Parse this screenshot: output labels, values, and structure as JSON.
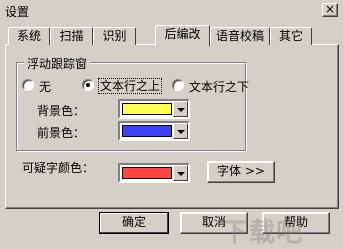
{
  "window": {
    "title": "设置",
    "close_label": "×"
  },
  "tabs": [
    {
      "label": "系统"
    },
    {
      "label": "扫描"
    },
    {
      "label": "识别"
    },
    {
      "label": "后编改"
    },
    {
      "label": "语音校稿"
    },
    {
      "label": "其它"
    }
  ],
  "active_tab": "后编改",
  "tracking_group": {
    "title": "浮动跟踪窗",
    "options": [
      {
        "label": "无",
        "selected": false
      },
      {
        "label": "文本行之上",
        "selected": true
      },
      {
        "label": "文本行之下",
        "selected": false
      }
    ],
    "background": {
      "label": "背景色：",
      "color": "#ffff55"
    },
    "foreground": {
      "label": "前景色：",
      "color": "#3f3fff"
    }
  },
  "suspicious": {
    "label": "可疑字颜色：",
    "color": "#ff4444"
  },
  "font_button": "字体 >>",
  "buttons": {
    "ok": "确定",
    "cancel": "取消",
    "help": "帮助"
  },
  "watermark": "下载吧"
}
